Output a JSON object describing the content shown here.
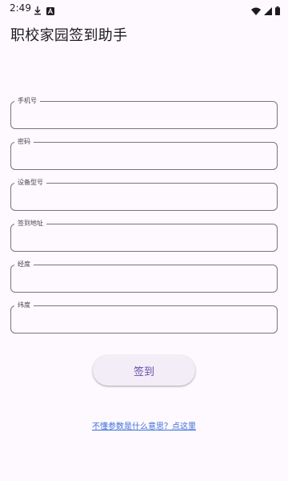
{
  "status_bar": {
    "time": "2:49",
    "left_icons": [
      "download-icon",
      "a-notification-icon"
    ],
    "right_icons": [
      "wifi-icon",
      "signal-icon",
      "battery-icon"
    ]
  },
  "app": {
    "title": "职校家园签到助手"
  },
  "form": {
    "fields": [
      {
        "label": "手机号",
        "value": ""
      },
      {
        "label": "密码",
        "value": ""
      },
      {
        "label": "设备型号",
        "value": ""
      },
      {
        "label": "签到地址",
        "value": ""
      },
      {
        "label": "经度",
        "value": ""
      },
      {
        "label": "纬度",
        "value": ""
      }
    ]
  },
  "actions": {
    "submit_label": "签到",
    "help_link": "不懂参数是什么意思？点这里"
  },
  "colors": {
    "background": "#fdf9ff",
    "accent": "#6750a4",
    "link": "#3f6fd8",
    "outline": "#79747e"
  }
}
